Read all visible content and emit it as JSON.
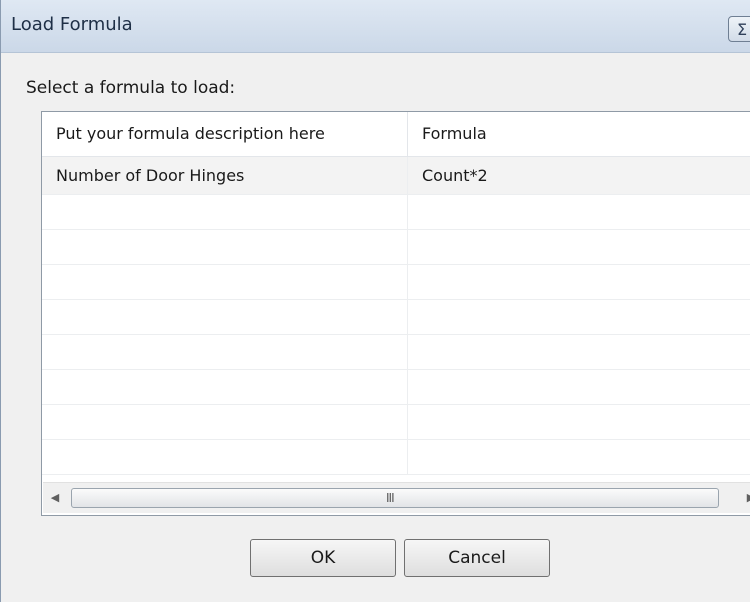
{
  "dialog": {
    "title": "Load Formula",
    "close_glyph": "Σ"
  },
  "prompt": "Select a formula to load:",
  "list": {
    "columns": [
      "Put your formula description here",
      "Formula"
    ],
    "rows": [
      [
        "Number of Door Hinges",
        "Count*2"
      ]
    ]
  },
  "scrollbar": {
    "left_arrow": "◀",
    "right_arrow": "▶",
    "grip": "III"
  },
  "buttons": {
    "ok_label": "OK",
    "cancel_label": "Cancel"
  }
}
